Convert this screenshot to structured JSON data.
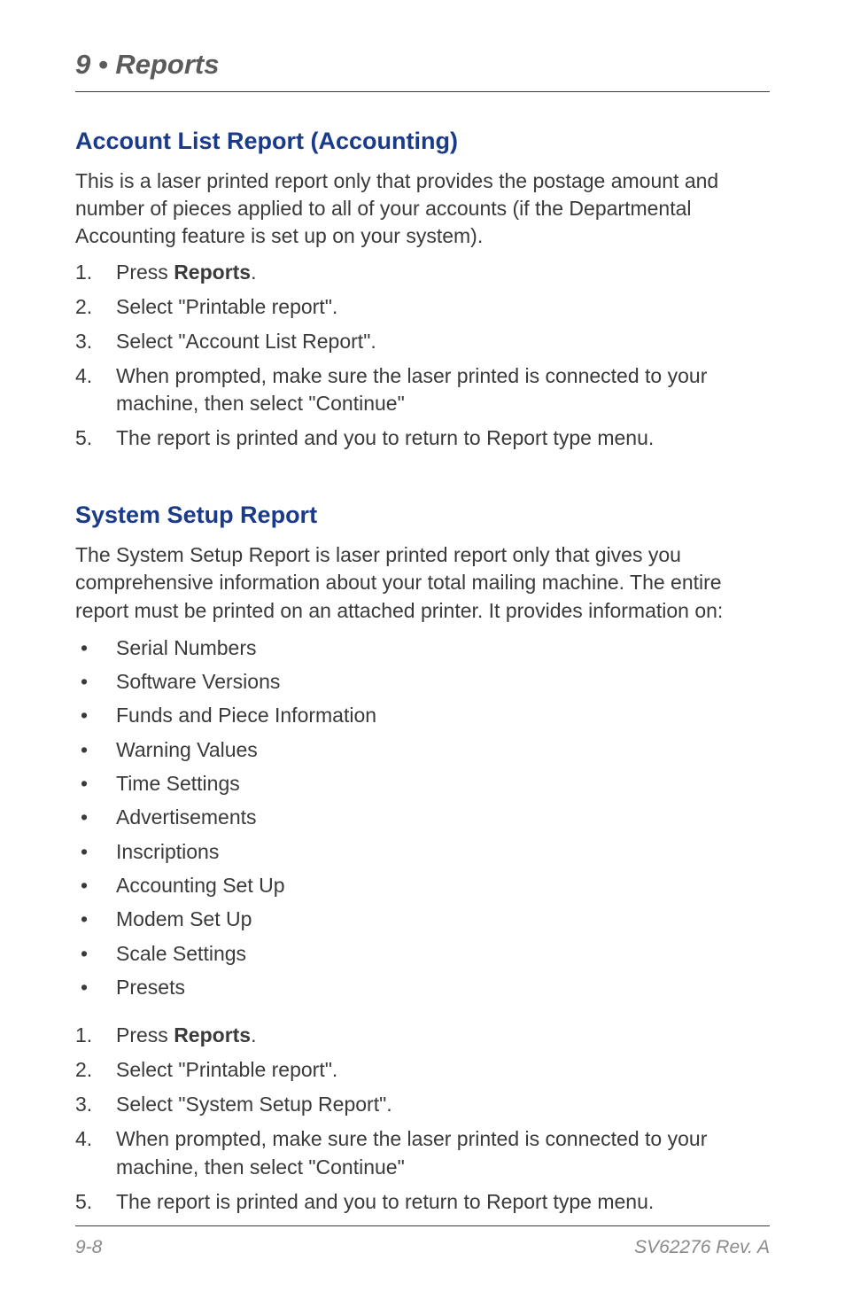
{
  "header": {
    "chapter": "9 • Reports"
  },
  "section1": {
    "title": "Account List Report (Accounting)",
    "intro": "This is a laser printed report only that provides the postage amount and number of pieces applied to all of your accounts (if the Departmental Accounting feature is set up on your system).",
    "steps": [
      {
        "prefix": "Press ",
        "bold": "Reports",
        "suffix": "."
      },
      {
        "text": "Select \"Printable report\"."
      },
      {
        "text": "Select \"Account List Report\"."
      },
      {
        "text": "When prompted, make sure the laser printed is connected to your machine, then select \"Continue\""
      },
      {
        "text": "The report is printed and you to return to Report type menu."
      }
    ]
  },
  "section2": {
    "title": "System Setup Report",
    "intro": "The System Setup Report is laser printed report only that gives you comprehensive information about your total mailing machine. The entire report must be printed on an attached printer. It provides information on:",
    "bullets": [
      "Serial Numbers",
      "Software Versions",
      " Funds and Piece Information",
      "Warning Values",
      "Time Settings",
      "Advertisements",
      "Inscriptions",
      "Accounting Set Up",
      "Modem Set Up",
      "Scale Settings",
      "Presets"
    ],
    "steps": [
      {
        "prefix": "Press ",
        "bold": "Reports",
        "suffix": "."
      },
      {
        "text": "Select \"Printable report\"."
      },
      {
        "text": "Select \"System Setup Report\"."
      },
      {
        "text": "When prompted, make sure the laser printed is connected to your machine, then select \"Continue\""
      },
      {
        "text": "The report is printed and you to return to Report type menu."
      }
    ]
  },
  "footer": {
    "page": "9-8",
    "rev": "SV62276 Rev. A"
  }
}
